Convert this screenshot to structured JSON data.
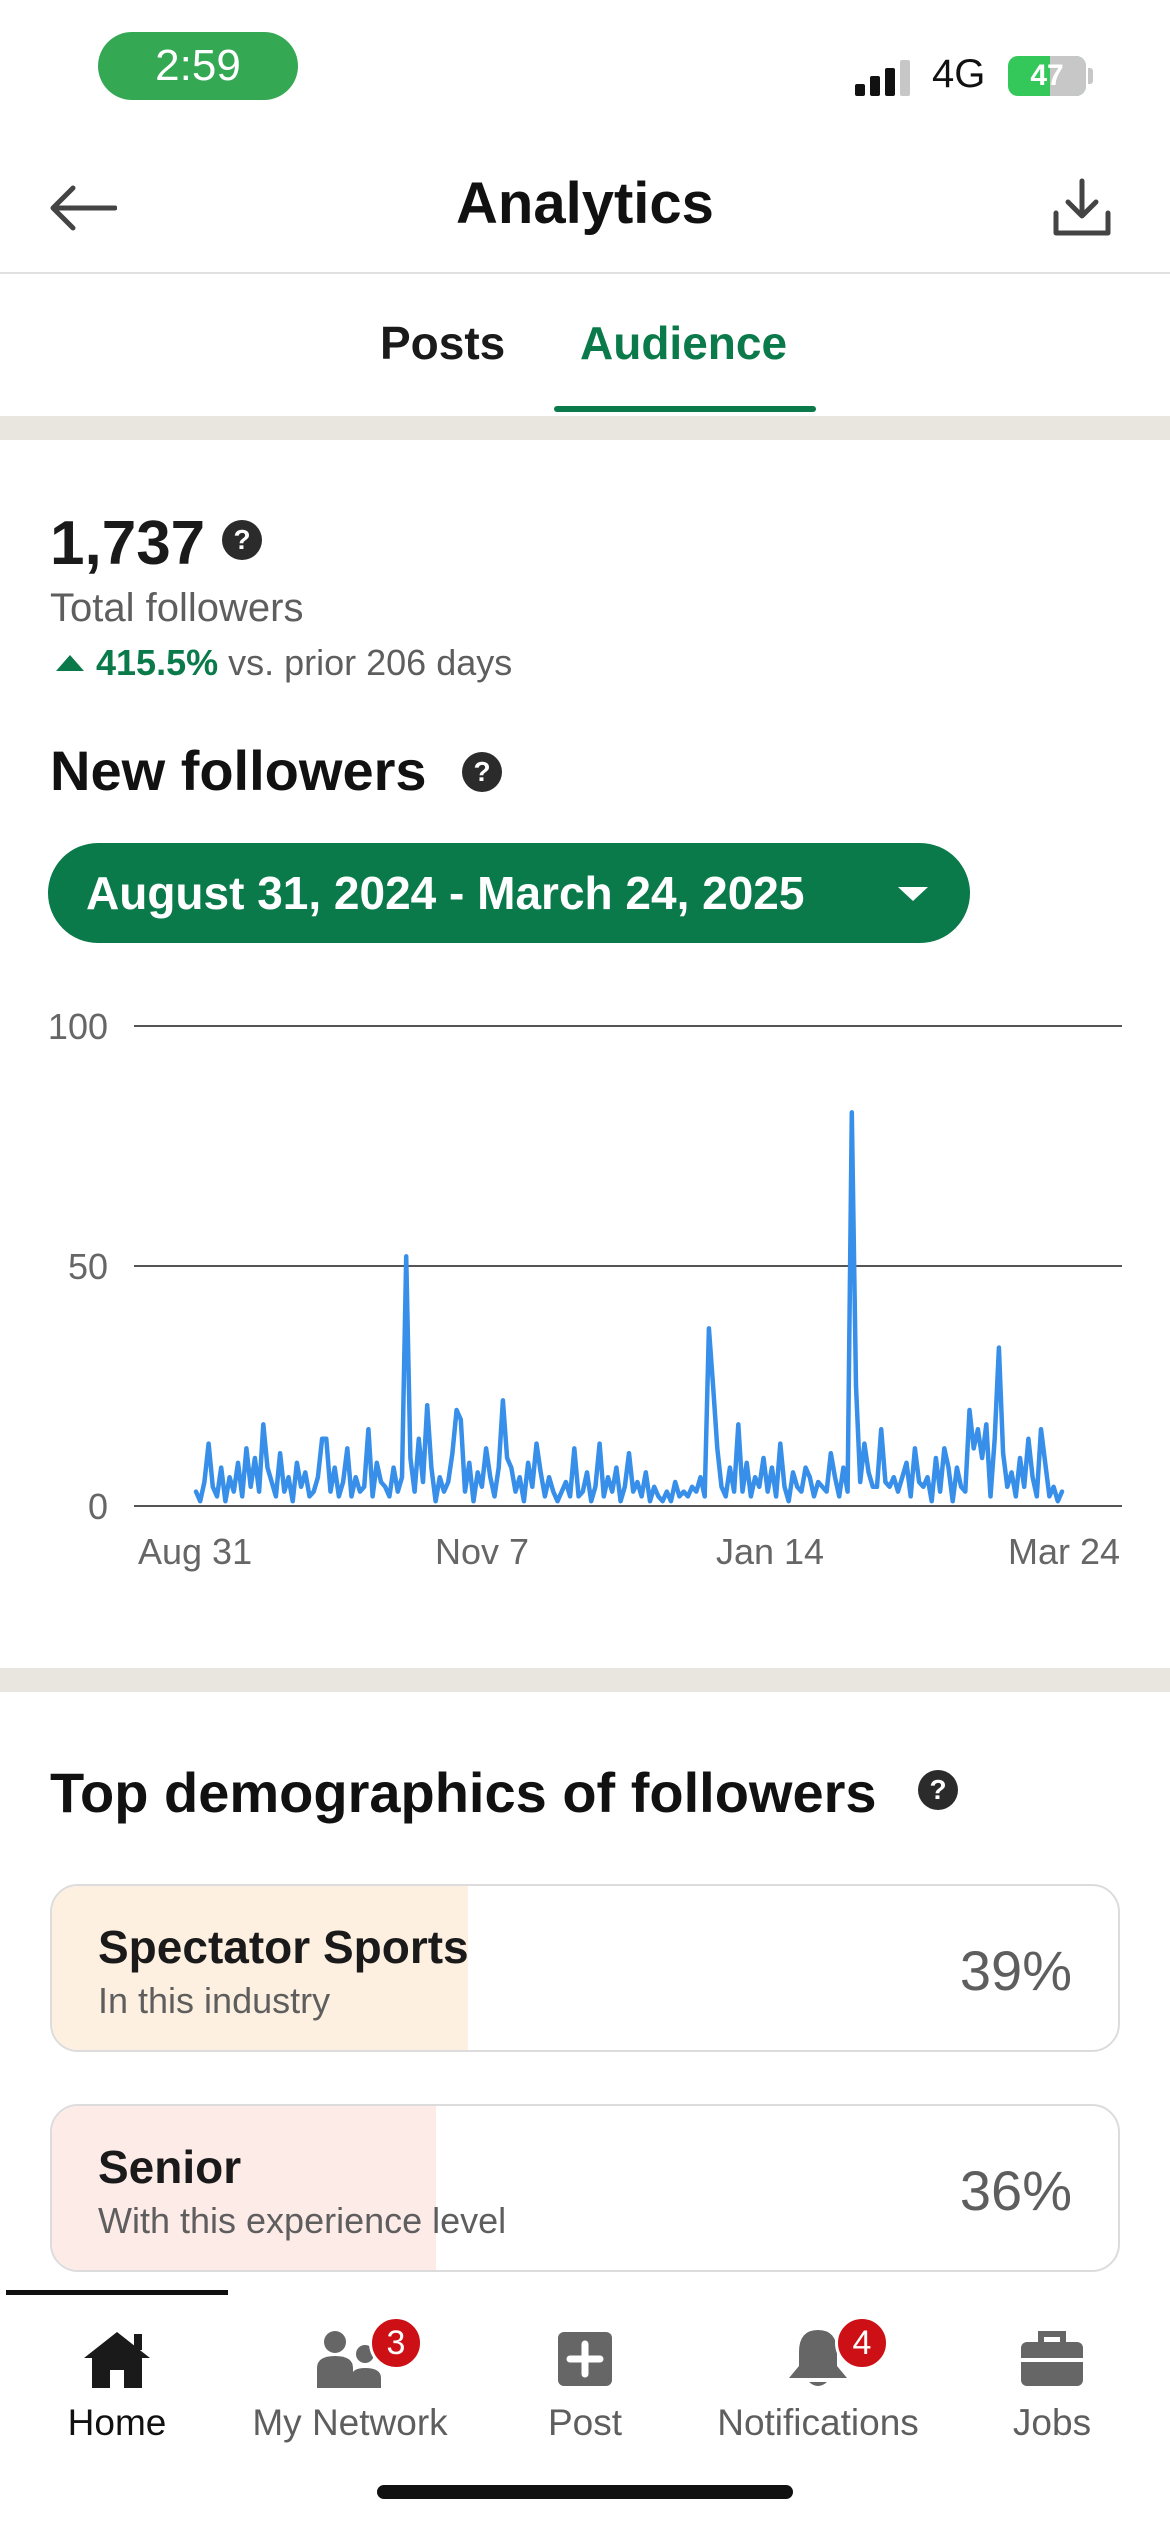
{
  "status_bar": {
    "time": "2:59",
    "network": "4G",
    "battery": "47"
  },
  "header": {
    "title": "Analytics",
    "back_icon": "arrow-left-icon",
    "download_icon": "download-icon"
  },
  "tabs": [
    {
      "label": "Posts",
      "active": false
    },
    {
      "label": "Audience",
      "active": true
    }
  ],
  "summary": {
    "total_followers": "1,737",
    "total_label": "Total followers",
    "growth_pct": "415.5%",
    "growth_text": "vs. prior 206 days",
    "help_glyph": "?"
  },
  "new_followers": {
    "title": "New followers",
    "date_range": "August 31, 2024 - March 24, 2025"
  },
  "chart_data": {
    "type": "line",
    "title": "",
    "xlabel": "",
    "ylabel": "",
    "ylim": [
      0,
      100
    ],
    "y_ticks": [
      "0",
      "50",
      "100"
    ],
    "x_ticks": [
      "Aug 31",
      "Nov 7",
      "Jan 14",
      "Mar 24"
    ],
    "grid": true,
    "color": "#378fe9",
    "series": [
      {
        "values": [
          3,
          1,
          5,
          13,
          4,
          2,
          8,
          1,
          6,
          3,
          9,
          2,
          12,
          4,
          10,
          3,
          17,
          8,
          5,
          2,
          11,
          3,
          6,
          1,
          9,
          4,
          7,
          2,
          3,
          6,
          14,
          14,
          3,
          8,
          2,
          5,
          12,
          2,
          6,
          3,
          4,
          16,
          2,
          9,
          5,
          4,
          2,
          8,
          3,
          6,
          52,
          10,
          3,
          14,
          5,
          21,
          8,
          1,
          6,
          3,
          5,
          11,
          20,
          18,
          3,
          9,
          1,
          7,
          4,
          12,
          6,
          2,
          8,
          22,
          10,
          8,
          3,
          6,
          1,
          9,
          4,
          13,
          7,
          2,
          6,
          3,
          1,
          3,
          5,
          2,
          12,
          2,
          3,
          7,
          1,
          4,
          13,
          2,
          6,
          3,
          8,
          1,
          4,
          11,
          3,
          5,
          2,
          7,
          1,
          4,
          2,
          1,
          3,
          1,
          5,
          2,
          3,
          2,
          4,
          3,
          6,
          2,
          37,
          25,
          12,
          4,
          2,
          8,
          3,
          17,
          3,
          9,
          2,
          6,
          4,
          10,
          3,
          8,
          2,
          13,
          4,
          1,
          7,
          4,
          3,
          8,
          6,
          2,
          5,
          4,
          3,
          11,
          6,
          2,
          8,
          3,
          82,
          25,
          5,
          13,
          7,
          4,
          4,
          16,
          5,
          4,
          6,
          3,
          6,
          9,
          2,
          12,
          5,
          4,
          6,
          1,
          10,
          3,
          12,
          8,
          1,
          8,
          4,
          3,
          20,
          12,
          16,
          10,
          17,
          2,
          14,
          33,
          11,
          4,
          7,
          2,
          10,
          4,
          14,
          6,
          2,
          16,
          9,
          2,
          4,
          1,
          3
        ]
      }
    ]
  },
  "demographics": {
    "title": "Top demographics of followers",
    "items": [
      {
        "name": "Spectator Sports",
        "sub": "In this industry",
        "pct": "39%",
        "fraction": 0.39,
        "color": "#fdf0e0"
      },
      {
        "name": "Senior",
        "sub": "With this experience level",
        "pct": "36%",
        "fraction": 0.36,
        "color": "#fdebe8"
      }
    ]
  },
  "bottom_nav": [
    {
      "label": "Home",
      "icon": "home-icon",
      "active": true,
      "badge": ""
    },
    {
      "label": "My Network",
      "icon": "network-icon",
      "active": false,
      "badge": "3"
    },
    {
      "label": "Post",
      "icon": "plus-square-icon",
      "active": false,
      "badge": ""
    },
    {
      "label": "Notifications",
      "icon": "bell-icon",
      "active": false,
      "badge": "4"
    },
    {
      "label": "Jobs",
      "icon": "briefcase-icon",
      "active": false,
      "badge": ""
    }
  ],
  "colors": {
    "accent": "#0a7a4a",
    "badge": "#cc1016",
    "line": "#378fe9"
  }
}
